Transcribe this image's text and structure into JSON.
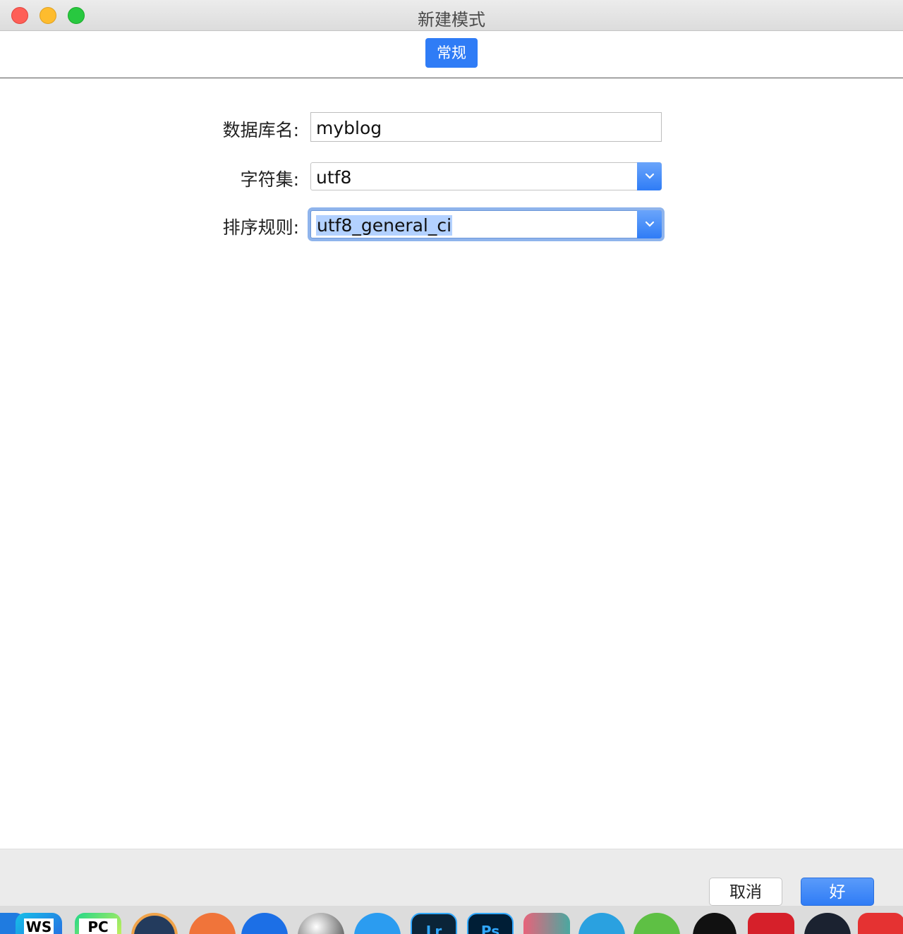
{
  "window": {
    "title": "新建模式"
  },
  "tabs": [
    {
      "label": "常规",
      "active": true
    }
  ],
  "form": {
    "database_name": {
      "label": "数据库名:",
      "value": "myblog"
    },
    "charset": {
      "label": "字符集:",
      "value": "utf8"
    },
    "collation": {
      "label": "排序规则:",
      "value": "utf8_general_ci"
    }
  },
  "buttons": {
    "cancel": "取消",
    "ok": "好"
  },
  "dock": {
    "apps": [
      {
        "icon": "webstorm-icon",
        "label": "WS"
      },
      {
        "icon": "pycharm-icon",
        "label": "PC"
      },
      {
        "icon": "app-icon"
      },
      {
        "icon": "postman-icon"
      },
      {
        "icon": "app-icon"
      },
      {
        "icon": "cinema4d-icon"
      },
      {
        "icon": "app-icon"
      },
      {
        "icon": "lightroom-icon",
        "label": "Lr"
      },
      {
        "icon": "photoshop-icon",
        "label": "Ps"
      },
      {
        "icon": "app-icon"
      },
      {
        "icon": "telegram-icon"
      },
      {
        "icon": "wechat-icon"
      },
      {
        "icon": "qq-icon"
      },
      {
        "icon": "netease-music-icon"
      },
      {
        "icon": "app-icon"
      },
      {
        "icon": "youdao-icon"
      }
    ]
  },
  "colors": {
    "accent": "#2f7cf6",
    "selection": "#b3d1ff"
  }
}
